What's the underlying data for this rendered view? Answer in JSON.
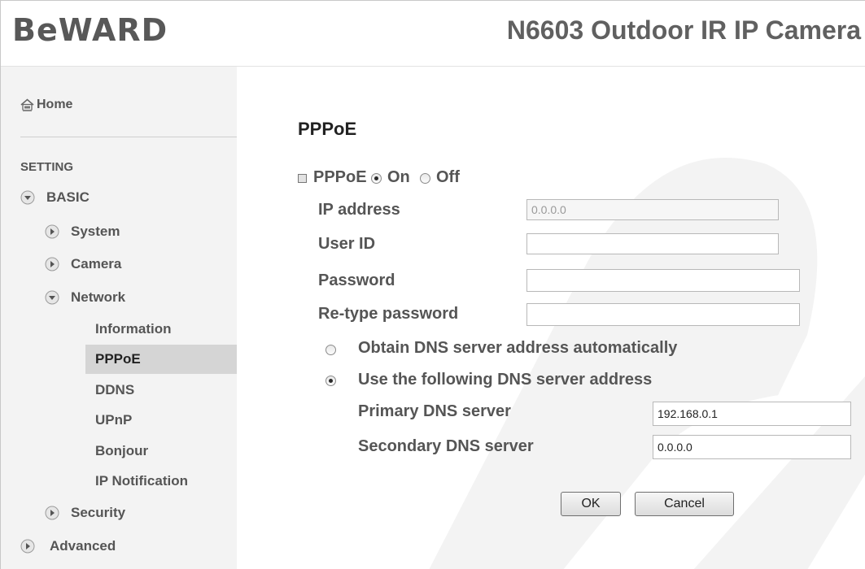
{
  "header": {
    "logo": "BeWARD",
    "model": "N6603 Outdoor IR IP Camera"
  },
  "sidebar": {
    "home": "Home",
    "section": "SETTING",
    "basic": "BASIC",
    "system": "System",
    "camera": "Camera",
    "network": "Network",
    "subitems": [
      "Information",
      "PPPoE",
      "DDNS",
      "UPnP",
      "Bonjour",
      "IP Notification"
    ],
    "security": "Security",
    "advanced": "Advanced"
  },
  "main": {
    "title": "PPPoE",
    "pppoe_label": "PPPoE",
    "on_label": "On",
    "off_label": "Off",
    "ip_address_label": "IP address",
    "ip_address_value": "0.0.0.0",
    "user_id_label": "User ID",
    "user_id_value": "",
    "password_label": "Password",
    "password_value": "",
    "retype_label": "Re-type password",
    "retype_value": "",
    "dns_auto_label": "Obtain DNS server address automatically",
    "dns_manual_label": "Use the following DNS server address",
    "primary_dns_label": "Primary DNS server",
    "primary_dns_value": "192.168.0.1",
    "secondary_dns_label": "Secondary DNS server",
    "secondary_dns_value": "0.0.0.0",
    "ok_label": "OK",
    "cancel_label": "Cancel"
  },
  "colors": {
    "sidebar_bg": "#f3f3f3",
    "active_item_bg": "#d5d5d5",
    "watermark": "#f2f2f2"
  },
  "icons": {
    "home": "home-icon",
    "expanded": "chevron-down-icon",
    "collapsed": "chevron-right-icon"
  }
}
